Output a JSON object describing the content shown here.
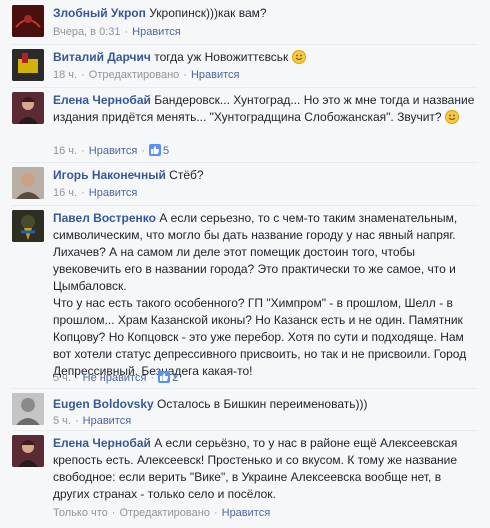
{
  "comments": [
    {
      "author": "Злобный Укроп",
      "text": "Укропинск)))как вам?",
      "time": "Вчера, в 0:31",
      "action": "Нравится",
      "edited": "",
      "likes": "",
      "colors": {
        "avatar": "#6a1a1a"
      }
    },
    {
      "author": "Виталий Дарчич",
      "text": "тогда уж Новожиттєвськ",
      "time": "18 ч.",
      "edited": "Отредактировано",
      "action": "Нравится",
      "likes": "",
      "colors": {
        "avatar": "#2b2b2b"
      }
    },
    {
      "author": "Елена Чернобай",
      "text": "Бандеровск... Хунтоград... Но это ж мне тогда и название издания придётся менять... \"Хунтоградщина Слобожанская\". Звучит?",
      "time": "16 ч.",
      "action": "Нравится",
      "edited": "",
      "likes": "5",
      "colors": {
        "avatar": "#7a3040"
      }
    },
    {
      "author": "Игорь Наконечный",
      "text": "Стёб?",
      "time": "16 ч.",
      "action": "Нравится",
      "edited": "",
      "likes": "",
      "colors": {
        "avatar": "#8c7a6a"
      }
    },
    {
      "author": "Павел Востренко",
      "text": "А если серьезно, то с чем-то таким знаменательным, символическим, что могло бы дать название городу у нас явный напряг. Лихачев? А на самом ли деле этот помещик достоин того, чтобы увековечить его в названии города? Это практически то же самое, что и Цымбаловск.",
      "text2": "Что у нас есть такого особенного? ГП \"Химпром\" - в прошлом, Шелл - в прошлом... Храм Казанской иконы? Но Казанск есть и не один. Памятник Копцову? Но Копцовск - это уже перебор. Хотя по сути и подходяще. Нам вот хотели статус депрессивного присвоить, но так и не присвоили. Город Депрессивный. Безнадега какая-то!",
      "time": "5 ч.",
      "action": "Не нравится",
      "edited": "",
      "likes": "2",
      "colors": {
        "avatar": "#3a3a2a"
      }
    },
    {
      "author": "Eugen Boldovsky",
      "text": "Осталось в Бишкин переименовать)))",
      "time": "5 ч.",
      "action": "Нравится",
      "edited": "",
      "likes": "",
      "colors": {
        "avatar": "#9a9a9a"
      }
    },
    {
      "author": "Елена Чернобай",
      "text": "А если серьёзно, то у нас в районе ещё Алексеевская крепость есть. Алексеевск! Простенько и со вкусом. К тому же название свободное: если верить \"Вике\", в Украине Алексеевска вообще нет, в других странах - только село и посёлок.",
      "time": "Только что",
      "edited": "Отредактировано",
      "action": "Нравится",
      "likes": "",
      "colors": {
        "avatar": "#7a3040"
      }
    }
  ],
  "icons": {
    "like": "thumbs-up-icon",
    "smile": "smile-emoji-icon"
  }
}
